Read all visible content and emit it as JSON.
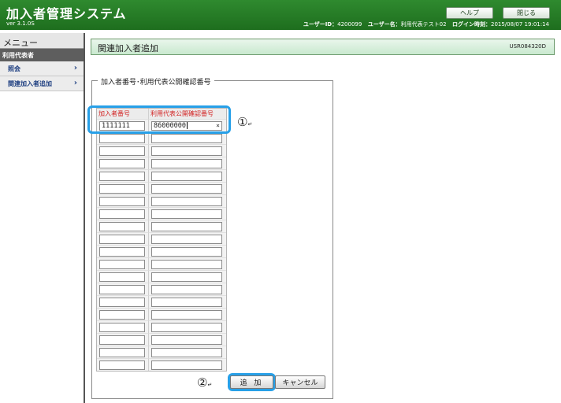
{
  "header": {
    "title": "加入者管理システム",
    "version": "ver 3.1.0S",
    "help_label": "ヘルプ",
    "close_label": "閉じる",
    "user_id_label": "ユーザーID：",
    "user_id": "4200099",
    "user_name_label": "ユーザー名：",
    "user_name": "利用代表テスト02",
    "login_time_label": "ログイン時刻：",
    "login_time": "2015/08/07 19:01:14"
  },
  "sidebar": {
    "title": "メニュー",
    "section": "利用代表者",
    "items": [
      {
        "label": "照会",
        "chevron": "›"
      },
      {
        "label": "関連加入者追加",
        "chevron": "›"
      }
    ]
  },
  "page": {
    "title": "関連加入者追加",
    "screen_id": "USR084320D"
  },
  "form": {
    "legend": "加入者番号･利用代表公開確認番号",
    "col1_header": "加入者番号",
    "col2_header": "利用代表公開確認番号",
    "rows": [
      {
        "subscriber_no": "1111111",
        "confirm_no": "86000000"
      },
      {
        "subscriber_no": "",
        "confirm_no": ""
      },
      {
        "subscriber_no": "",
        "confirm_no": ""
      },
      {
        "subscriber_no": "",
        "confirm_no": ""
      },
      {
        "subscriber_no": "",
        "confirm_no": ""
      },
      {
        "subscriber_no": "",
        "confirm_no": ""
      },
      {
        "subscriber_no": "",
        "confirm_no": ""
      },
      {
        "subscriber_no": "",
        "confirm_no": ""
      },
      {
        "subscriber_no": "",
        "confirm_no": ""
      },
      {
        "subscriber_no": "",
        "confirm_no": ""
      },
      {
        "subscriber_no": "",
        "confirm_no": ""
      },
      {
        "subscriber_no": "",
        "confirm_no": ""
      },
      {
        "subscriber_no": "",
        "confirm_no": ""
      },
      {
        "subscriber_no": "",
        "confirm_no": ""
      },
      {
        "subscriber_no": "",
        "confirm_no": ""
      },
      {
        "subscriber_no": "",
        "confirm_no": ""
      },
      {
        "subscriber_no": "",
        "confirm_no": ""
      },
      {
        "subscriber_no": "",
        "confirm_no": ""
      },
      {
        "subscriber_no": "",
        "confirm_no": ""
      },
      {
        "subscriber_no": "",
        "confirm_no": ""
      }
    ],
    "clear_icon": "×",
    "add_label": "追 加",
    "cancel_label": "キャンセル"
  },
  "annotations": {
    "marker1": "①",
    "marker2": "②",
    "return_mark": "↵"
  },
  "colors": {
    "header_green": "#2f8a2f",
    "callout_blue": "#27a0e8",
    "required_red": "#d21f1f"
  }
}
